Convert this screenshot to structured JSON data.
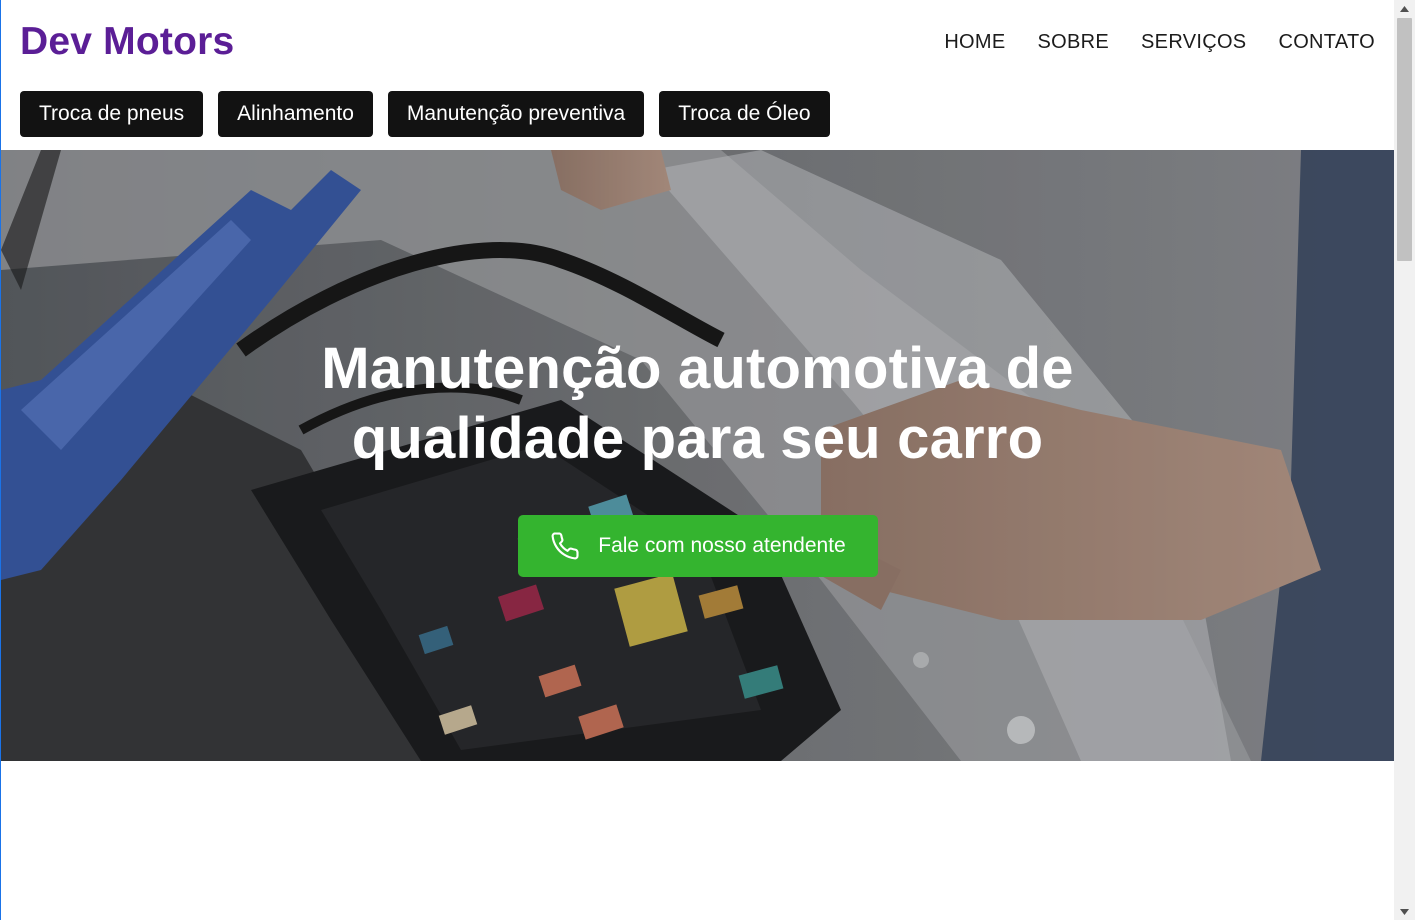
{
  "header": {
    "logo": "Dev Motors",
    "nav": [
      {
        "label": "HOME"
      },
      {
        "label": "SOBRE"
      },
      {
        "label": "SERVIÇOS"
      },
      {
        "label": "CONTATO"
      }
    ],
    "services": [
      {
        "label": "Troca de pneus"
      },
      {
        "label": "Alinhamento"
      },
      {
        "label": "Manutenção preventiva"
      },
      {
        "label": "Troca de Óleo"
      }
    ]
  },
  "hero": {
    "title_line1": "Manutenção automotiva de",
    "title_line2": "qualidade para seu carro",
    "cta_label": "Fale com nosso atendente",
    "cta_icon": "phone-icon",
    "background": "car-engine-fuse-box-photo"
  },
  "colors": {
    "brand": "#5b1e96",
    "pill_bg": "#121212",
    "cta_bg": "#34b42f"
  }
}
